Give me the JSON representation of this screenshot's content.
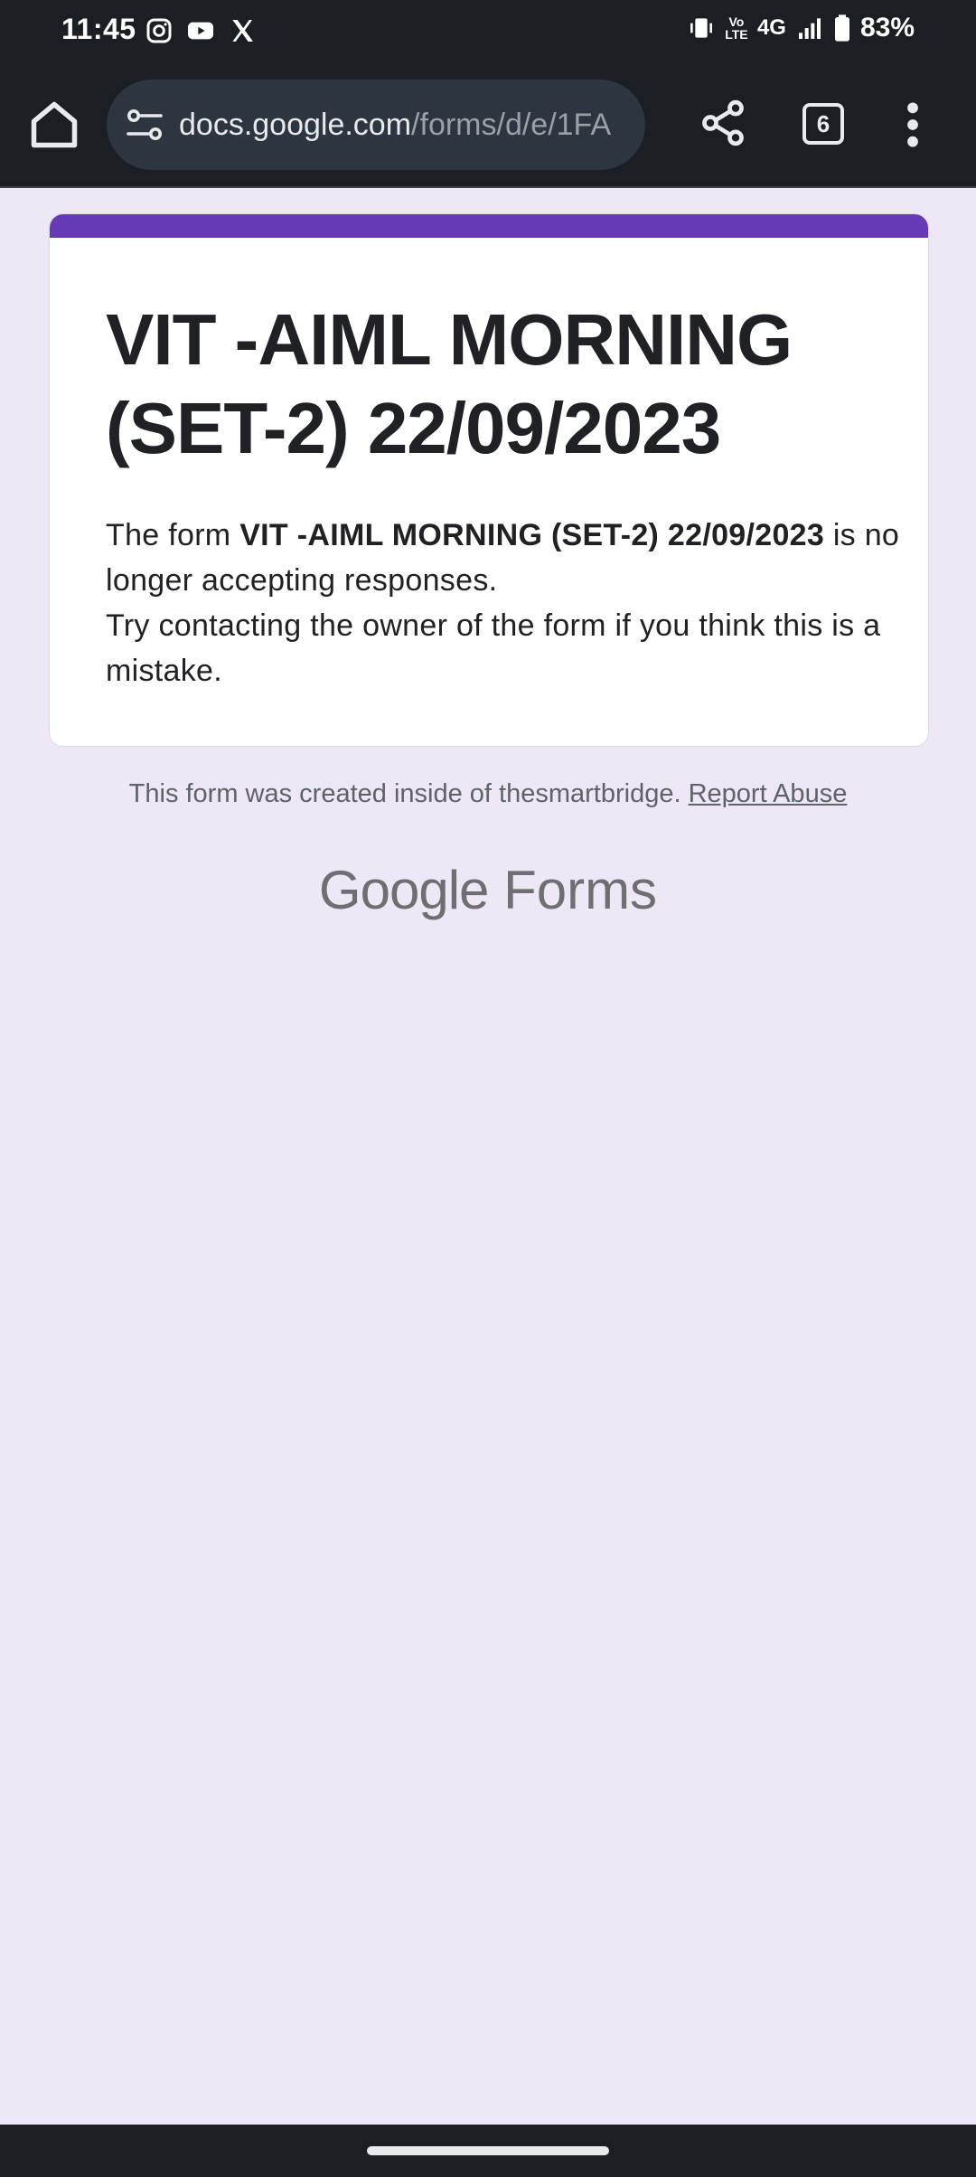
{
  "status_bar": {
    "time": "11:45",
    "app_icons": [
      "instagram-icon",
      "youtube-icon",
      "x-icon"
    ],
    "network": "4G",
    "volte": "Vo LTE",
    "battery": "83%"
  },
  "browser": {
    "url_host": "docs.google.com",
    "url_path": "/forms/d/e/1FA",
    "tab_count": "6"
  },
  "form": {
    "accent_color": "#673ab7",
    "title": "VIT -AIML MORNING (SET-2) 22/09/2023",
    "message_prefix": "The form ",
    "message_form_name": "VIT -AIML MORNING (SET-2) 22/09/2023",
    "message_suffix": " is no longer accepting responses.",
    "message_line2": "Try contacting the owner of the form if you think this is a mistake."
  },
  "footer": {
    "created_note": "This form was created inside of thesmartbridge.",
    "report_link": "Report Abuse",
    "logo_google": "Google",
    "logo_forms": "Forms"
  }
}
